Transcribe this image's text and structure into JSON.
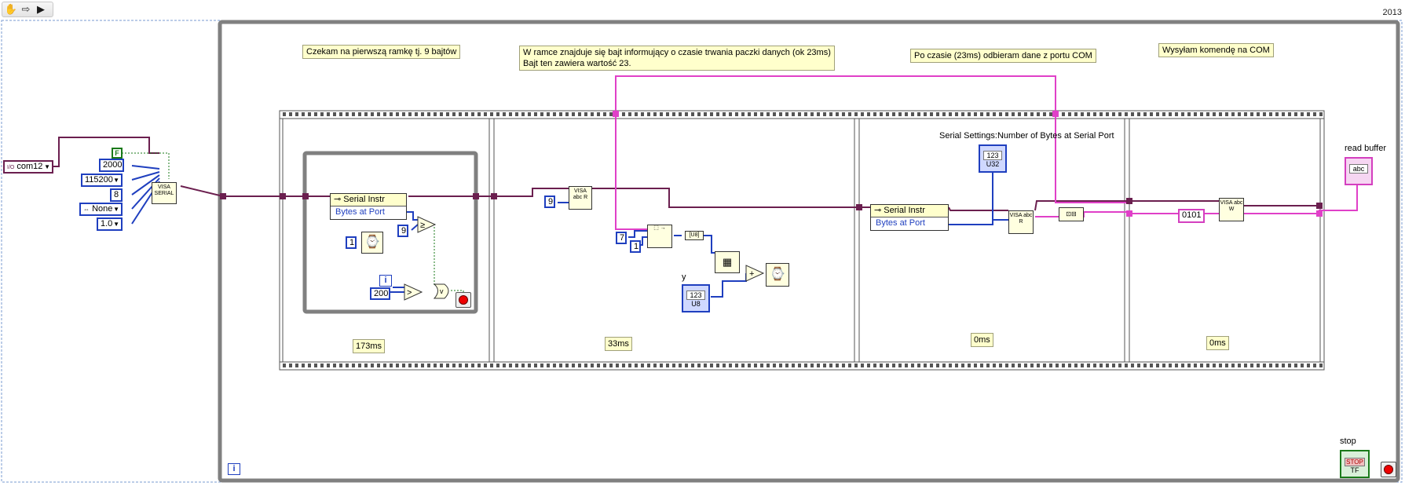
{
  "toolbar": {
    "items": [
      {
        "icon": "hand-icon",
        "glyph": "✋"
      },
      {
        "icon": "arrow-right-icon",
        "glyph": "⇨"
      },
      {
        "icon": "run-icon",
        "glyph": "▶"
      }
    ]
  },
  "version": "2013",
  "notes": {
    "frame1": "Czekam na pierwszą ramkę tj. 9 bajtów",
    "frame2_line1": "W ramce znajduje się bajt informujący o czasie trwania paczki danych (ok 23ms)",
    "frame2_line2": "Bajt ten zawiera wartość 23.",
    "frame3": "Po czasie  (23ms) odbieram dane z portu COM",
    "frame4": "Wysyłam komendę na COM"
  },
  "controls": {
    "visa_resource": "com12",
    "visa_prefix": "I/O",
    "constant_f": "F",
    "timeout": "2000",
    "baud_rate": "115200",
    "data_bits": "8",
    "parity": "None",
    "stop_bits": "1.0"
  },
  "serial_open_label": "VISA SERIAL",
  "frame1": {
    "property_node_class": "Serial Instr",
    "property_node_prop": "Bytes at Port",
    "wait_const": "1",
    "compare_const": "9",
    "iter_const": "200",
    "iter_label": "i",
    "time": "173ms"
  },
  "frame2": {
    "read_count": "9",
    "subset_offset": "7",
    "subset_length": "1",
    "indicator_label": "y",
    "indicator_text": "123",
    "indicator_type": "U8",
    "time": "33ms"
  },
  "frame3": {
    "property_node_class": "Serial Instr",
    "property_node_prop": "Bytes at Port",
    "indicator_caption": "Serial Settings:Number of Bytes at Serial Port",
    "indicator_text": "123",
    "indicator_type": "U32",
    "time": "0ms"
  },
  "frame4": {
    "write_const": "0101",
    "time": "0ms"
  },
  "read_buffer": {
    "label": "read buffer",
    "text": "abc"
  },
  "stop": {
    "label": "stop",
    "text": "STOP",
    "type": "TF"
  },
  "while_loop_iter": "i",
  "colors": {
    "visa_wire": "#6b1f4f",
    "string_wire": "#e040c8",
    "int_wire": "#1f3fbf",
    "bool_wire": "#1a7a1a",
    "loop_frame": "#808080",
    "note_bg": "#ffffcc"
  }
}
